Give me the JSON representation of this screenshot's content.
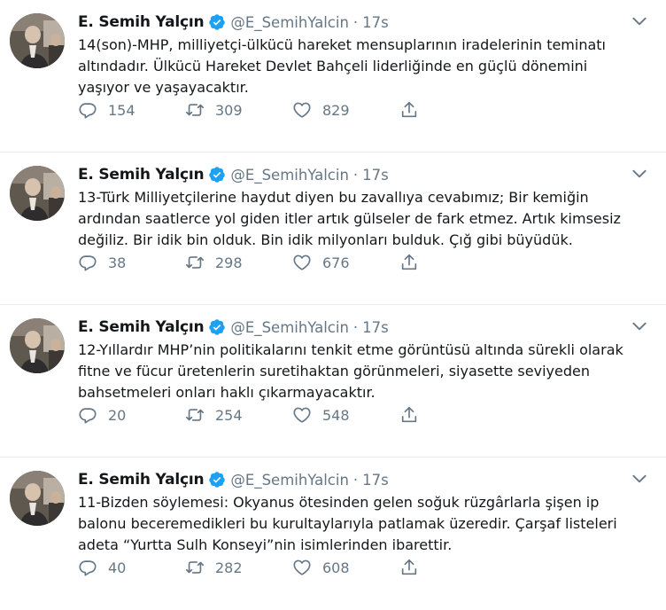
{
  "colors": {
    "accent": "#1da1f2",
    "text": "#14171a",
    "muted": "#657786",
    "divider": "#e6ecf0"
  },
  "tweets": [
    {
      "name": "E. Semih Yalçın",
      "handle": "@E_SemihYalcin",
      "dot": "·",
      "time": "17s",
      "lines": [
        "14(son)-MHP, milliyetçi-ülkücü hareket mensuplarının iradelerinin teminatı",
        "altındadır. Ülkücü Hareket Devlet Bahçeli liderliğinde en güçlü dönemini",
        "yaşıyor ve yaşayacaktır."
      ],
      "replies": "154",
      "retweets": "309",
      "likes": "829"
    },
    {
      "name": "E. Semih Yalçın",
      "handle": "@E_SemihYalcin",
      "dot": "·",
      "time": "17s",
      "lines": [
        "13-Türk Milliyetçilerine haydut diyen bu zavallıya cevabımız; Bir kemiğin",
        "ardından saatlerce yol giden itler artık gülseler de fark etmez. Artık kimsesiz",
        "değiliz. Bir idik bin olduk. Bin idik milyonları bulduk. Çığ gibi büyüdük."
      ],
      "replies": "38",
      "retweets": "298",
      "likes": "676"
    },
    {
      "name": "E. Semih Yalçın",
      "handle": "@E_SemihYalcin",
      "dot": "·",
      "time": "17s",
      "lines": [
        "12-Yıllardır MHP’nin politikalarını tenkit etme görüntüsü altında sürekli olarak",
        "fitne ve fücur üretenlerin suretihaktan görünmeleri, siyasette seviyeden",
        "bahsetmeleri onları haklı çıkarmayacaktır."
      ],
      "replies": "20",
      "retweets": "254",
      "likes": "548"
    },
    {
      "name": "E. Semih Yalçın",
      "handle": "@E_SemihYalcin",
      "dot": "·",
      "time": "17s",
      "lines": [
        "11-Bizden söylemesi: Okyanus ötesinden gelen soğuk rüzgârlarla şişen ip",
        "balonu beceremedikleri bu kurultaylarıyla patlamak üzeredir. Çarşaf listeleri",
        "adeta “Yurtta Sulh Konseyi”nin isimlerinden ibarettir."
      ],
      "replies": "40",
      "retweets": "282",
      "likes": "608"
    }
  ],
  "icons": {
    "verified": "verified-badge-icon",
    "caret": "chevron-down-icon",
    "reply": "reply-icon",
    "retweet": "retweet-icon",
    "like": "heart-icon",
    "share": "share-icon"
  }
}
